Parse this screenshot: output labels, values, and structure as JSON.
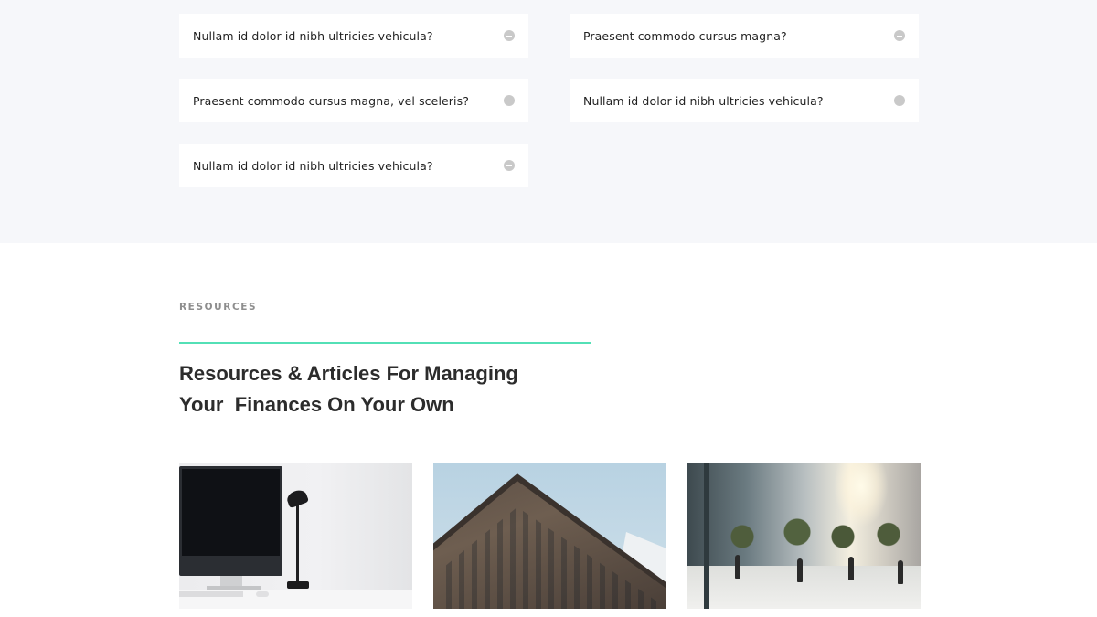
{
  "faq": {
    "items": [
      {
        "question": "Nullam id dolor id nibh ultricies vehicula?"
      },
      {
        "question": "Praesent commodo cursus magna?"
      },
      {
        "question": "Praesent commodo cursus magna, vel sceleris?"
      },
      {
        "question": "Nullam id dolor id nibh ultricies vehicula?"
      },
      {
        "question": "Nullam id dolor id nibh ultricies vehicula?"
      }
    ],
    "toggle_icon": "collapse-circle-icon"
  },
  "resources": {
    "eyebrow": "RESOURCES",
    "heading_line1": "Resources & Articles For Managing",
    "heading_line2": "Your  Finances On Your Own",
    "accent_color": "#53e0b6",
    "cards": [
      {
        "image": "desk-computer-lamp-photo"
      },
      {
        "image": "building-corner-photo"
      },
      {
        "image": "city-street-people-photo"
      }
    ]
  }
}
